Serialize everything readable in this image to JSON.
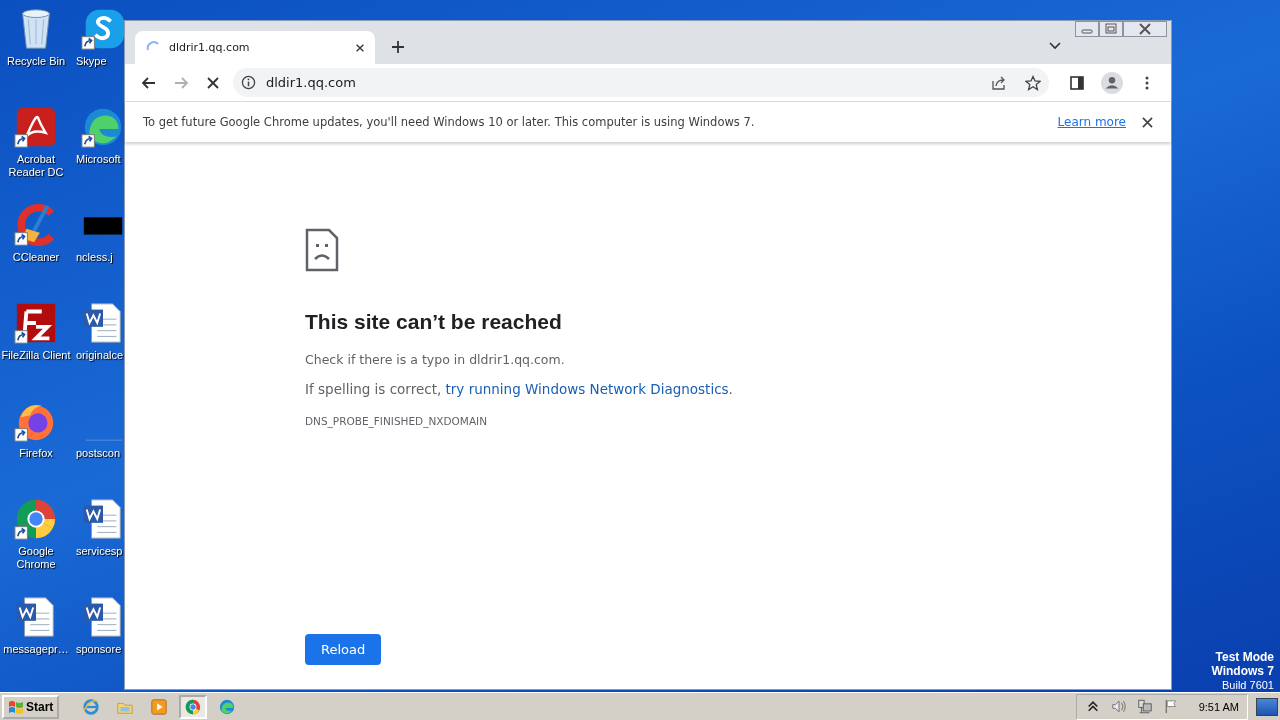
{
  "desktop_icons": [
    {
      "label": "Recycle Bin",
      "kind": "recycle",
      "shortcut": false
    },
    {
      "label": "Acrobat Reader DC",
      "kind": "acrobat",
      "shortcut": true
    },
    {
      "label": "CCleaner",
      "kind": "ccleaner",
      "shortcut": true
    },
    {
      "label": "FileZilla Client",
      "kind": "filezilla",
      "shortcut": true
    },
    {
      "label": "Firefox",
      "kind": "firefox",
      "shortcut": true
    },
    {
      "label": "Google Chrome",
      "kind": "chrome",
      "shortcut": true
    },
    {
      "label": "messagepr…",
      "kind": "word",
      "shortcut": false
    },
    {
      "label": "Skype",
      "kind": "skype",
      "shortcut": true
    },
    {
      "label": "Microsoft",
      "kind": "edge",
      "shortcut": true
    },
    {
      "label": "ncless.j",
      "kind": "black",
      "shortcut": false
    },
    {
      "label": "originalce",
      "kind": "word",
      "shortcut": false
    },
    {
      "label": "postscon",
      "kind": "blank",
      "shortcut": false
    },
    {
      "label": "servicesp",
      "kind": "word",
      "shortcut": false
    },
    {
      "label": "sponsore",
      "kind": "word",
      "shortcut": false
    }
  ],
  "desktop_notice": [
    "Test Mode",
    "Windows 7",
    "Build 7601"
  ],
  "browser": {
    "tabs": [
      {
        "title": "dldrir1.qq.com",
        "selected": true,
        "loading": true
      }
    ],
    "forward_disabled": true,
    "address": "dldir1.qq.com",
    "infobar": {
      "message": "To get future Google Chrome updates, you'll need Windows 10 or later. This computer is using Windows 7.",
      "link": "Learn more"
    },
    "error": {
      "title": "This site can’t be reached",
      "typo_hint": "Check if there is a typo in dldrir1.qq.com.",
      "spelling_prefix": "If spelling is correct, ",
      "spelling_link": "try running Windows Network Diagnostics",
      "spelling_suffix": ".",
      "code": "DNS_PROBE_FINISHED_NXDOMAIN",
      "button": "Reload"
    }
  },
  "taskbar": {
    "start": "Start",
    "apps": [
      {
        "kind": "ie",
        "selected": false
      },
      {
        "kind": "folder",
        "selected": false
      },
      {
        "kind": "media",
        "selected": false
      },
      {
        "kind": "chrome",
        "selected": true
      },
      {
        "kind": "edge",
        "selected": false
      }
    ],
    "clock": "9:51 AM"
  }
}
